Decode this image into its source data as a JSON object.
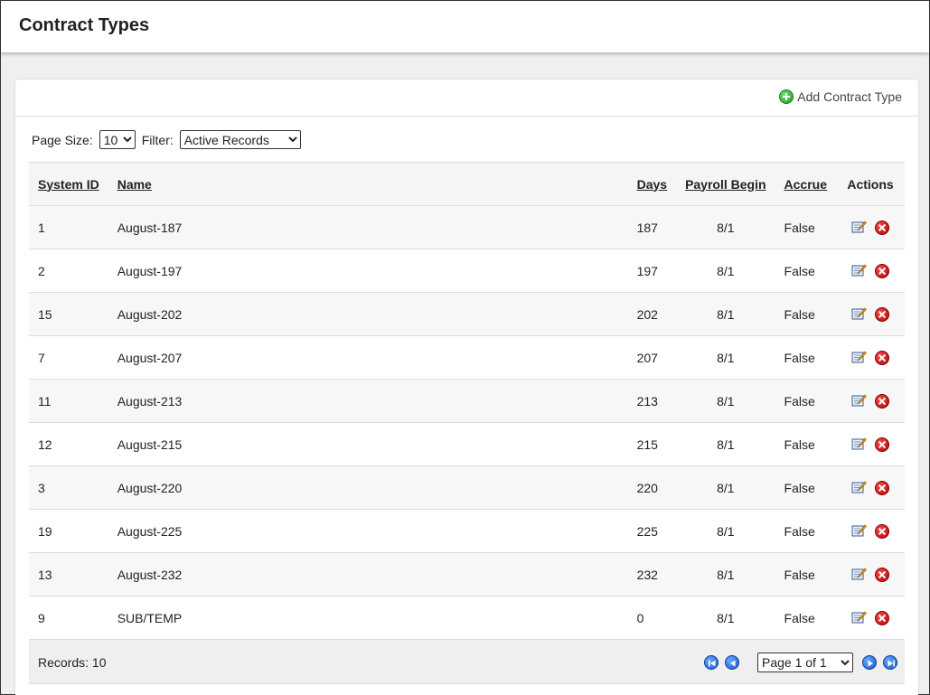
{
  "page": {
    "title": "Contract Types"
  },
  "toolbar": {
    "add_label": "Add Contract Type"
  },
  "controls": {
    "page_size_label": "Page Size:",
    "page_size_value": "10",
    "filter_label": "Filter:",
    "filter_value": "Active Records"
  },
  "table": {
    "headers": {
      "system_id": "System ID",
      "name": "Name",
      "days": "Days",
      "payroll_begin": "Payroll Begin",
      "accrue": "Accrue",
      "actions": "Actions"
    },
    "rows": [
      {
        "system_id": "1",
        "name": "August-187",
        "days": "187",
        "payroll_begin": "8/1",
        "accrue": "False"
      },
      {
        "system_id": "2",
        "name": "August-197",
        "days": "197",
        "payroll_begin": "8/1",
        "accrue": "False"
      },
      {
        "system_id": "15",
        "name": "August-202",
        "days": "202",
        "payroll_begin": "8/1",
        "accrue": "False"
      },
      {
        "system_id": "7",
        "name": "August-207",
        "days": "207",
        "payroll_begin": "8/1",
        "accrue": "False"
      },
      {
        "system_id": "11",
        "name": "August-213",
        "days": "213",
        "payroll_begin": "8/1",
        "accrue": "False"
      },
      {
        "system_id": "12",
        "name": "August-215",
        "days": "215",
        "payroll_begin": "8/1",
        "accrue": "False"
      },
      {
        "system_id": "3",
        "name": "August-220",
        "days": "220",
        "payroll_begin": "8/1",
        "accrue": "False"
      },
      {
        "system_id": "19",
        "name": "August-225",
        "days": "225",
        "payroll_begin": "8/1",
        "accrue": "False"
      },
      {
        "system_id": "13",
        "name": "August-232",
        "days": "232",
        "payroll_begin": "8/1",
        "accrue": "False"
      },
      {
        "system_id": "9",
        "name": "SUB/TEMP",
        "days": "0",
        "payroll_begin": "8/1",
        "accrue": "False"
      }
    ]
  },
  "footer": {
    "records_label": "Records: 10",
    "page_select_value": "Page 1 of 1"
  },
  "icons": {
    "add": "plus-circle-icon",
    "edit": "edit-icon",
    "delete": "delete-icon",
    "first": "first-page-icon",
    "prev": "prev-page-icon",
    "next": "next-page-icon",
    "last": "last-page-icon"
  },
  "colors": {
    "add_green": "#1e9e1e",
    "delete_red": "#b80000",
    "nav_blue": "#1558c8"
  }
}
